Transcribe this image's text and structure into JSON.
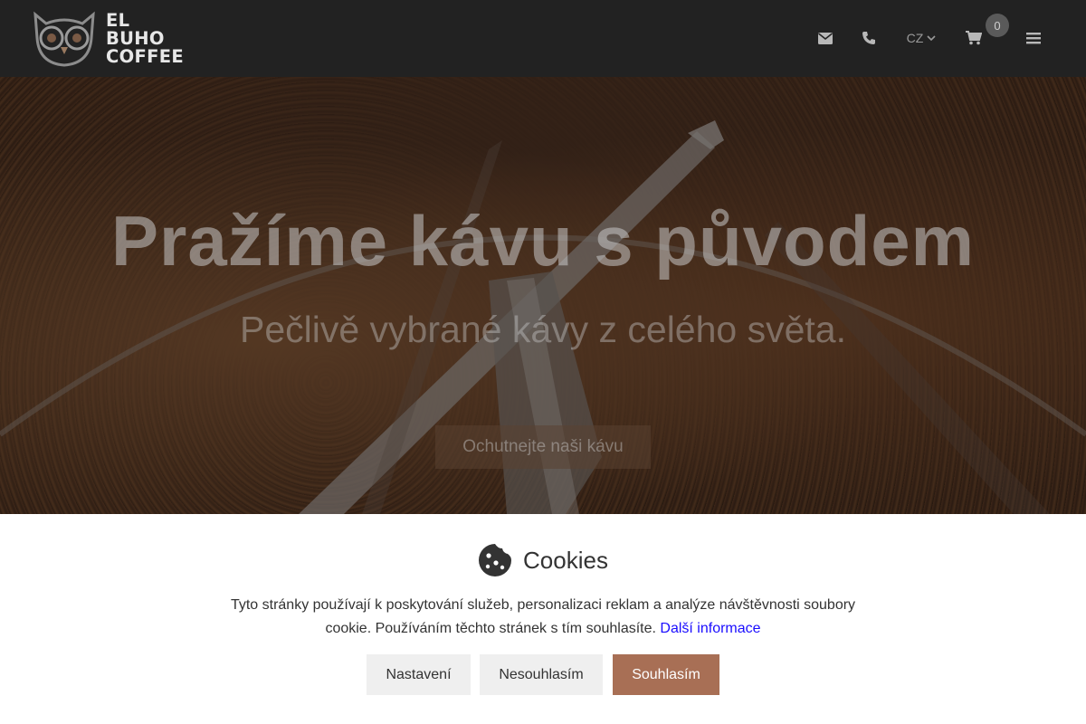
{
  "brand": {
    "logo_lines": [
      "EL",
      "BUHO",
      "COFFEE"
    ]
  },
  "header": {
    "icons": [
      "envelope-icon",
      "phone-icon",
      "shopping-cart-icon",
      "hamburger-menu-icon"
    ],
    "language": "CZ",
    "cart_count": "0"
  },
  "hero": {
    "title": "Pražíme kávu s původem",
    "subtitle": "Pečlivě vybrané kávy z celého světa.",
    "cta_label": "Ochutnejte naši kávu"
  },
  "cookie_banner": {
    "title": "Cookies",
    "text": "Tyto stránky používají k poskytování služeb, personalizaci reklam a analýze návštěvnosti soubory cookie. Používáním těchto stránek s tím souhlasíte.",
    "link_label": "Další informace",
    "settings_label": "Nastavení",
    "decline_label": "Nesouhlasím",
    "accept_label": "Souhlasím"
  },
  "colors": {
    "header_bg": "#222222",
    "accent": "#a86f55",
    "link": "#1a0dff"
  }
}
